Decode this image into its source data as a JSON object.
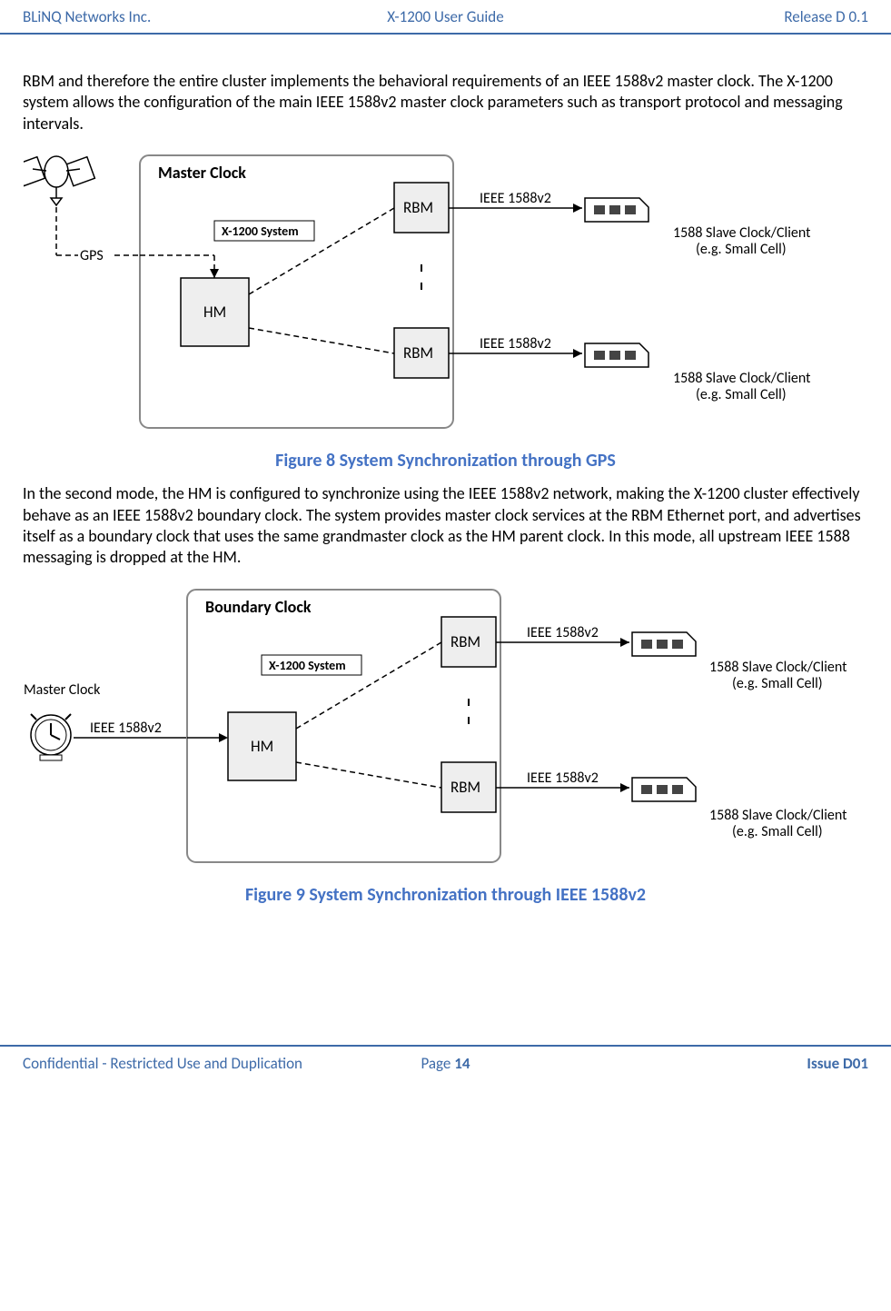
{
  "header": {
    "left": "BLiNQ Networks Inc.",
    "center": "X-1200 User Guide",
    "right": "Release D 0.1"
  },
  "footer": {
    "left": "Confidential - Restricted Use and Duplication",
    "center_prefix": "Page ",
    "page_number": "14",
    "right": "Issue D01"
  },
  "paragraph1": "RBM and therefore the entire cluster implements the behavioral requirements of an IEEE 1588v2 master clock. The X-1200 system allows the configuration of the main IEEE 1588v2 master clock parameters such as transport protocol and messaging intervals.",
  "paragraph2": "In the second mode, the HM is configured to synchronize using the IEEE 1588v2 network, making the X-1200 cluster effectively behave as an IEEE 1588v2 boundary clock. The system provides master clock services at the RBM Ethernet port, and advertises itself as a boundary clock that uses the same grandmaster clock as the HM parent clock. In this mode, all upstream IEEE 1588 messaging is dropped at the HM.",
  "caption1": "Figure 8   System Synchronization through GPS",
  "caption2": "Figure 9   System Synchronization through IEEE 1588v2",
  "diagram1": {
    "title": "Master Clock",
    "system_label": "X-1200 System",
    "gps_label": "GPS",
    "hm_label": "HM",
    "rbm_label": "RBM",
    "ieee_label": "IEEE 1588v2",
    "slave_line1": "1588 Slave Clock/Client",
    "slave_line2": "(e.g. Small Cell)"
  },
  "diagram2": {
    "title": "Boundary Clock",
    "system_label": "X-1200 System",
    "master_clock_label": "Master Clock",
    "hm_label": "HM",
    "rbm_label": "RBM",
    "ieee_label": "IEEE 1588v2",
    "slave_line1": "1588 Slave Clock/Client",
    "slave_line2": "(e.g. Small Cell)"
  }
}
